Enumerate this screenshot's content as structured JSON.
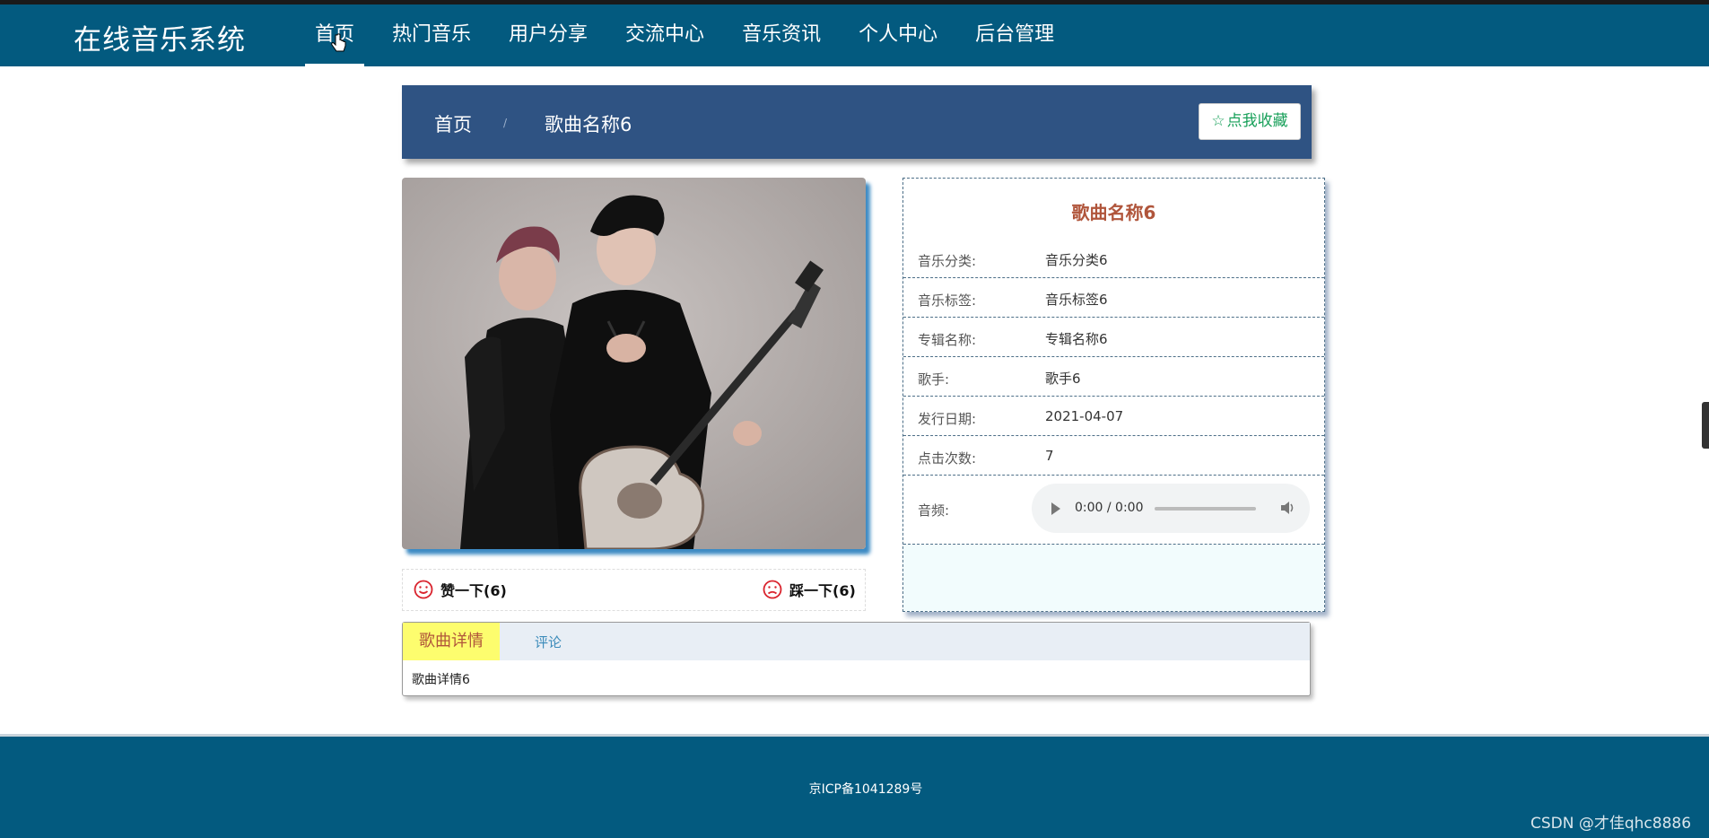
{
  "header": {
    "logo": "在线音乐系统",
    "nav": [
      {
        "label": "首页",
        "active": true
      },
      {
        "label": "热门音乐"
      },
      {
        "label": "用户分享"
      },
      {
        "label": "交流中心"
      },
      {
        "label": "音乐资讯"
      },
      {
        "label": "个人中心"
      },
      {
        "label": "后台管理"
      }
    ]
  },
  "breadcrumb": {
    "home": "首页",
    "separator": "/",
    "current": "歌曲名称6",
    "favorite_label": "点我收藏",
    "favorite_icon": "star-outline-icon"
  },
  "song": {
    "title": "歌曲名称6",
    "fields": [
      {
        "key": "音乐分类:",
        "value": "音乐分类6"
      },
      {
        "key": "音乐标签:",
        "value": "音乐标签6"
      },
      {
        "key": "专辑名称:",
        "value": "专辑名称6"
      },
      {
        "key": "歌手:",
        "value": "歌手6"
      },
      {
        "key": "发行日期:",
        "value": "2021-04-07"
      },
      {
        "key": "点击次数:",
        "value": "7"
      }
    ],
    "audio_label": "音频:",
    "audio_time": "0:00 / 0:00"
  },
  "reactions": {
    "like": "赞一下(6)",
    "dislike": "踩一下(6)"
  },
  "tabs": {
    "detail": "歌曲详情",
    "comment": "评论",
    "content": "歌曲详情6"
  },
  "footer": {
    "icp": "京ICP备1041289号"
  },
  "watermark": "CSDN @才佳qhc8886",
  "colors": {
    "header_bg": "#035a7f",
    "crumb_bg": "#2f5383",
    "title_color": "#b0553b",
    "fav_green": "#18a05a",
    "tab_active_bg": "#fdfd6e"
  }
}
